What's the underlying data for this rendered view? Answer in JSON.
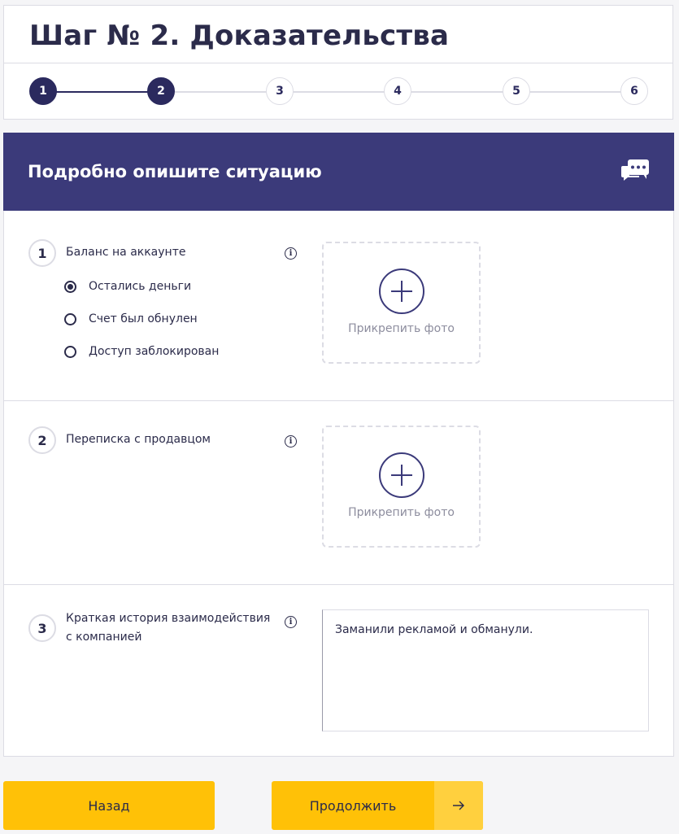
{
  "header": {
    "title": "Шаг № 2. Доказательства",
    "steps": [
      "1",
      "2",
      "3",
      "4",
      "5",
      "6"
    ],
    "current_step": 2
  },
  "banner": {
    "title": "Подробно опишите ситуацию",
    "icon": "chat-bubbles-icon"
  },
  "questions": [
    {
      "number": "1",
      "label": "Баланс на аккаунте",
      "options": [
        "Остались деньги",
        "Счет был обнулен",
        "Доступ заблокирован"
      ],
      "selected_option": 0,
      "upload_label": "Прикрепить фото"
    },
    {
      "number": "2",
      "label": "Переписка с продавцом",
      "upload_label": "Прикрепить фото"
    },
    {
      "number": "3",
      "label_line1": "Краткая история взаимодействия",
      "label_line2": "с компанией",
      "textarea_value": "Заманили рекламой и обманули."
    }
  ],
  "buttons": {
    "back_label": "Назад",
    "next_label": "Продолжить"
  },
  "colors": {
    "primary": "#3b3a7a",
    "accent": "#ffc107",
    "text": "#2b2b4a",
    "muted": "#8d8d9e",
    "border": "#dcdce4"
  }
}
